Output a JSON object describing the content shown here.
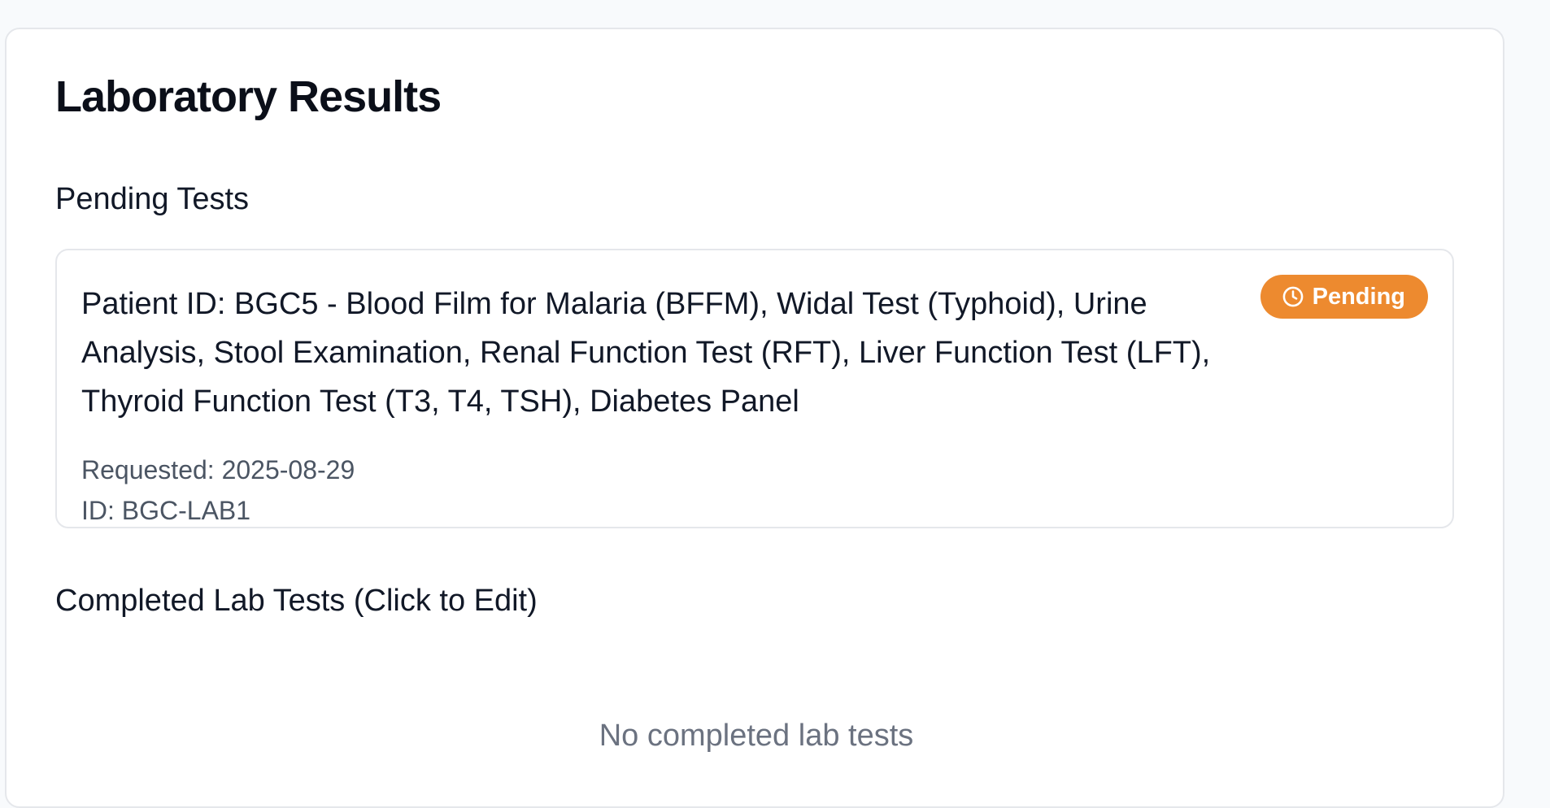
{
  "page": {
    "title": "Laboratory Results"
  },
  "pending_section": {
    "title": "Pending Tests",
    "items": [
      {
        "description": "Patient ID: BGC5 - Blood Film for Malaria (BFFM), Widal Test (Typhoid), Urine Analysis, Stool Examination, Renal Function Test (RFT), Liver Function Test (LFT), Thyroid Function Test (T3, T4, TSH), Diabetes Panel",
        "requested": "Requested: 2025-08-29",
        "id": "ID: BGC-LAB1",
        "status": {
          "label": "Pending",
          "icon": "clock-icon",
          "color": "#ed8a2f"
        }
      }
    ]
  },
  "completed_section": {
    "title": "Completed Lab Tests (Click to Edit)",
    "empty_message": "No completed lab tests"
  },
  "colors": {
    "background": "#f8fafc",
    "card": "#ffffff",
    "border": "#e5e7eb",
    "text_primary": "#111827",
    "text_secondary": "#4b5563",
    "text_muted": "#6b7280",
    "pending_accent": "#ed8a2f"
  }
}
